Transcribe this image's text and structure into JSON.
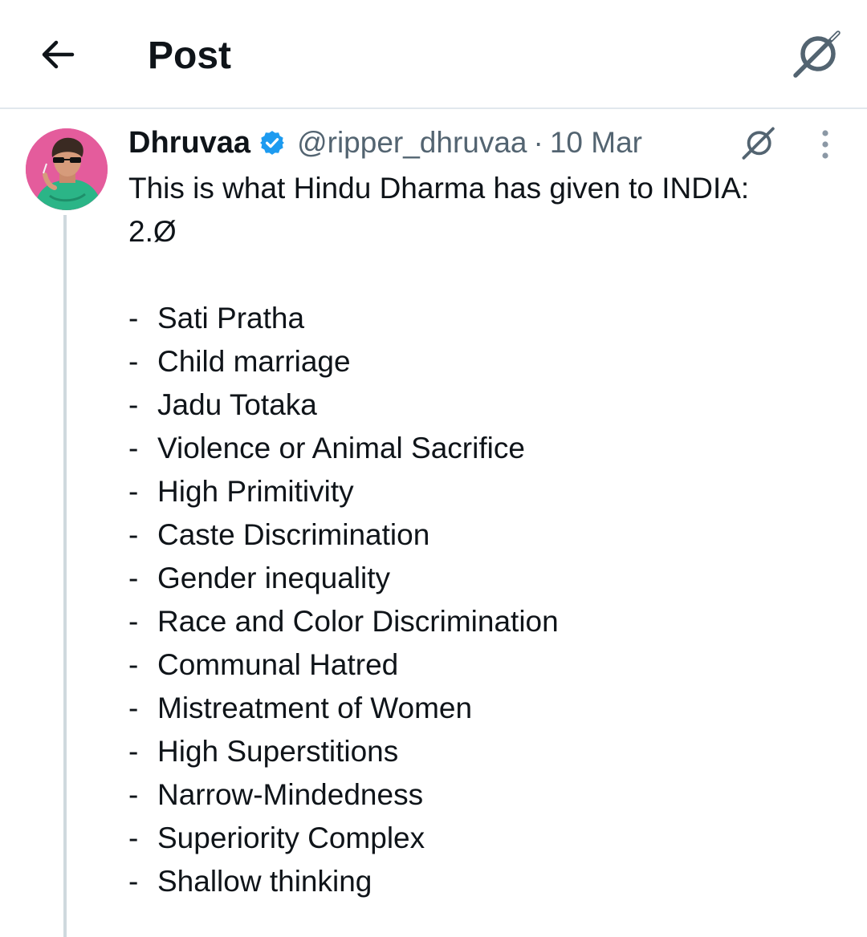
{
  "header": {
    "title": "Post",
    "back_icon": "arrow-left-icon",
    "grok_icon": "grok-icon"
  },
  "tweet": {
    "author_name": "Dhruvaa",
    "verified_icon": "verified-badge-icon",
    "handle": "@ripper_dhruvaa",
    "separator": "·",
    "date": "10 Mar",
    "text_line_1": "This is what Hindu Dharma has given to INDIA:",
    "text_line_2": "2.Ø",
    "list_bullet": "-",
    "list_items": [
      "Sati Pratha",
      "Child marriage",
      "Jadu Totaka",
      "Violence or Animal Sacrifice",
      "High Primitivity",
      "Caste Discrimination",
      "Gender inequality",
      "Race and Color Discrimination",
      "Communal Hatred",
      "Mistreatment of Women",
      "High Superstitions",
      "Narrow-Mindedness",
      "Superiority Complex",
      "Shallow thinking"
    ]
  },
  "colors": {
    "text_primary": "#0f1419",
    "text_secondary": "#536471",
    "verified_blue": "#1d9bf0",
    "divider": "#e1e8ed",
    "thread_line": "#cfd9de",
    "avatar_bg": "#e25a9a"
  }
}
